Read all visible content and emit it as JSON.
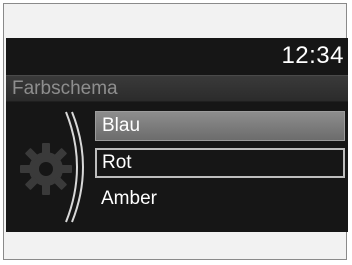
{
  "status_bar": {
    "clock": "12:34"
  },
  "header": {
    "title": "Farbschema"
  },
  "side_icon": "gear-icon",
  "menu": {
    "items": [
      {
        "label": "Blau",
        "state": "highlighted"
      },
      {
        "label": "Rot",
        "state": "selected"
      },
      {
        "label": "Amber",
        "state": "normal"
      }
    ]
  },
  "colors": {
    "screen_background": "#161616",
    "header_background": "#333333",
    "highlight": "#7d7d7d",
    "selection_border": "#bdbdbd",
    "text": "#ffffff",
    "header_text": "#8e8e8e"
  }
}
